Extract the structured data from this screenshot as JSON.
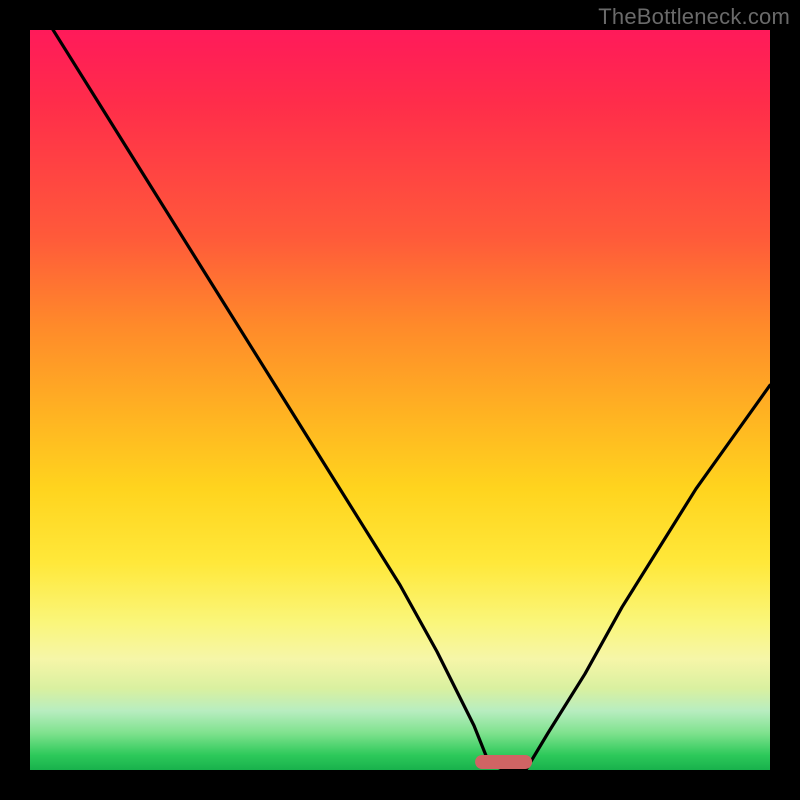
{
  "watermark": "TheBottleneck.com",
  "colors": {
    "frame": "#000000",
    "curve_stroke": "#000000",
    "min_marker": "#d06464"
  },
  "chart_data": {
    "type": "line",
    "title": "",
    "xlabel": "",
    "ylabel": "",
    "xlim": [
      0,
      100
    ],
    "ylim": [
      0,
      100
    ],
    "grid": false,
    "legend": false,
    "min_marker": {
      "x": 64,
      "y": 0,
      "width": 5
    },
    "series": [
      {
        "name": "bottleneck-curve",
        "x": [
          0,
          5,
          10,
          15,
          20,
          25,
          30,
          35,
          40,
          45,
          50,
          55,
          60,
          62,
          64,
          67,
          70,
          75,
          80,
          85,
          90,
          95,
          100
        ],
        "values": [
          105,
          97,
          89,
          81,
          73,
          65,
          57,
          49,
          41,
          33,
          25,
          16,
          6,
          1,
          0,
          0,
          5,
          13,
          22,
          30,
          38,
          45,
          52
        ]
      }
    ]
  }
}
